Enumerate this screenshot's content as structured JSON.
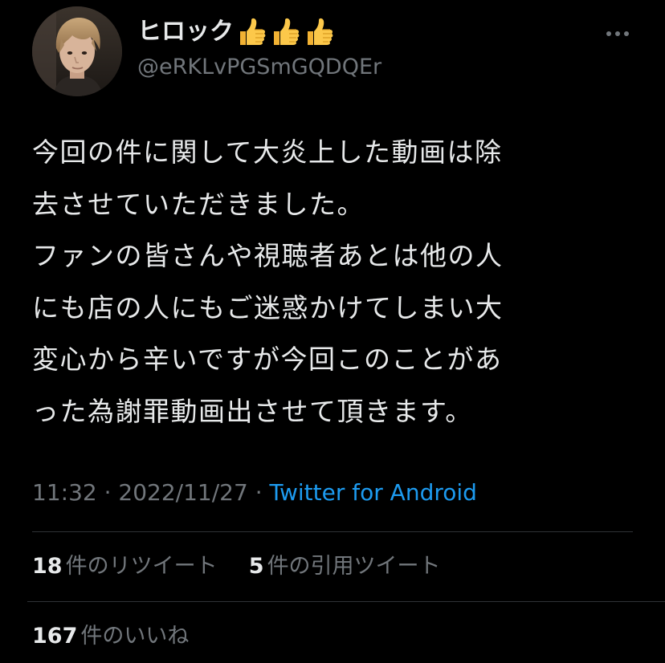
{
  "user": {
    "display_name": "ヒロック",
    "handle": "@eRKLvPGSmGQDQEr",
    "name_emoji": [
      "thumbs-up-icon",
      "thumbs-up-icon",
      "thumbs-up-icon"
    ],
    "avatar_icon": "avatar-photo"
  },
  "header": {
    "more_icon": "more-horizontal-icon"
  },
  "tweet": {
    "lines": [
      "今回の件に関して大炎上した動画は除",
      "去させていただきました。",
      "ファンの皆さんや視聴者あとは他の人",
      "にも店の人にもご迷惑かけてしまい大",
      "変心から辛いですが今回このことがあ",
      "った為謝罪動画出させて頂きます。"
    ]
  },
  "meta": {
    "time": "11:32",
    "separator": "·",
    "date": "2022/11/27",
    "source": "Twitter for Android"
  },
  "stats": {
    "retweets_count": "18",
    "retweets_label": "件のリツイート",
    "quotes_count": "5",
    "quotes_label": "件の引用ツイート",
    "likes_count": "167",
    "likes_label": "件のいいね"
  },
  "colors": {
    "background": "#000000",
    "primary_text": "#e7e9ea",
    "secondary_text": "#71767b",
    "link": "#1d9bf0",
    "divider": "#2f3336"
  }
}
